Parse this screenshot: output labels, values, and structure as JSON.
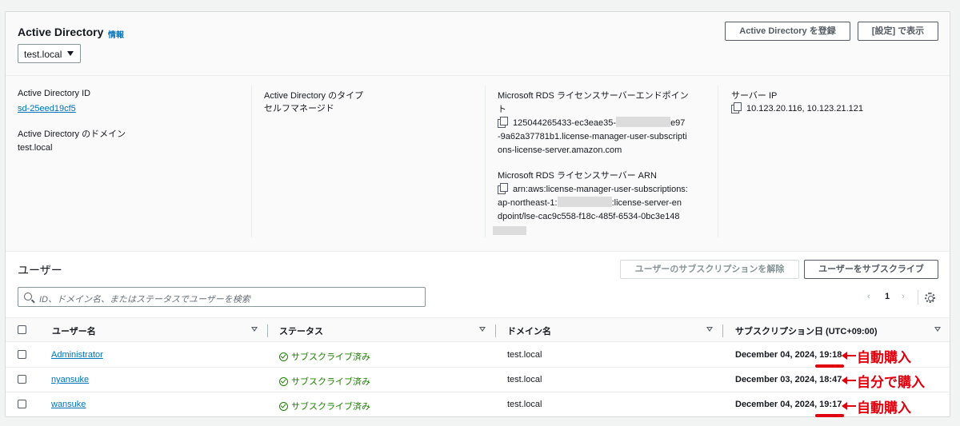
{
  "header": {
    "title": "Active Directory",
    "info": "情報",
    "selected_directory": "test.local",
    "register_button": "Active Directory を登録",
    "settings_button": "[設定] で表示"
  },
  "details": {
    "directory_id_label": "Active Directory ID",
    "directory_id_value": "sd-25eed19cf5",
    "domain_label": "Active Directory のドメイン",
    "domain_value": "test.local",
    "type_label": "Active Directory のタイプ",
    "type_value": "セルフマネージド",
    "endpoint_label_1": "Microsoft RDS ライセンスサーバーエンドポイン",
    "endpoint_label_2": "ト",
    "endpoint_value_1a": "125044265433-ec3eae35-",
    "endpoint_value_1b": "e97",
    "endpoint_value_2": "-9a62a37781b1.license-manager-user-subscripti",
    "endpoint_value_3": "ons-license-server.amazon.com",
    "arn_label": "Microsoft RDS ライセンスサーバー ARN",
    "arn_value_1": "arn:aws:license-manager-user-subscriptions:",
    "arn_value_2a": "ap-northeast-1:",
    "arn_value_2b": ":license-server-en",
    "arn_value_3": "dpoint/lse-cac9c558-f18c-485f-6534-0bc3e148",
    "server_ip_label": "サーバー IP",
    "server_ip_value": "10.123.20.116, 10.123.21.121"
  },
  "users": {
    "title": "ユーザー",
    "unsubscribe_button": "ユーザーのサブスクリプションを解除",
    "subscribe_button": "ユーザーをサブスクライブ",
    "search_placeholder": "ID、ドメイン名、またはステータスでユーザーを検索",
    "page": "1",
    "columns": [
      "ユーザー名",
      "ステータス",
      "ドメイン名",
      "サブスクリプション日 (UTC+09:00)"
    ],
    "rows": [
      {
        "user": "Administrator",
        "status": "サブスクライブ済み",
        "domain": "test.local",
        "date": "December 04, 2024, 19:18",
        "note": "自動購入"
      },
      {
        "user": "nyansuke",
        "status": "サブスクライブ済み",
        "domain": "test.local",
        "date": "December 03, 2024, 18:47",
        "note": "自分で購入"
      },
      {
        "user": "wansuke",
        "status": "サブスクライブ済み",
        "domain": "test.local",
        "date": "December 04, 2024, 19:17",
        "note": "自動購入"
      }
    ]
  },
  "colors": {
    "accent_link": "#0073bb",
    "status_ok": "#1d8102",
    "annotation": "#e0000d"
  }
}
